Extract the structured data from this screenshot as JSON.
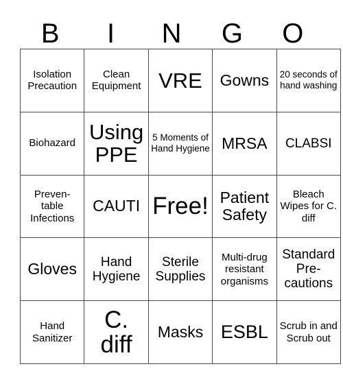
{
  "card": {
    "header_letters": [
      "B",
      "I",
      "N",
      "G",
      "O"
    ],
    "rows": [
      [
        {
          "text": "Isolation Precaution",
          "size": "fs-sm"
        },
        {
          "text": "Clean Equipment",
          "size": "fs-sm"
        },
        {
          "text": "VRE",
          "size": "fs-xxl"
        },
        {
          "text": "Gowns",
          "size": "fs-lg"
        },
        {
          "text": "20 seconds of hand washing",
          "size": "fs-xs"
        }
      ],
      [
        {
          "text": "Biohazard",
          "size": "fs-sm"
        },
        {
          "text": "Using PPE",
          "size": "fs-xxl"
        },
        {
          "text": "5 Moments of Hand Hygiene",
          "size": "fs-xs"
        },
        {
          "text": "MRSA",
          "size": "fs-lg"
        },
        {
          "text": "CLABSI",
          "size": "fs-md"
        }
      ],
      [
        {
          "text": "Preven- table Infections",
          "size": "fs-sm"
        },
        {
          "text": "CAUTI",
          "size": "fs-lg"
        },
        {
          "text": "Free!",
          "size": "fs-huge"
        },
        {
          "text": "Patient Safety",
          "size": "fs-lg"
        },
        {
          "text": "Bleach Wipes for C. diff",
          "size": "fs-sm"
        }
      ],
      [
        {
          "text": "Gloves",
          "size": "fs-lg"
        },
        {
          "text": "Hand Hygiene",
          "size": "fs-md"
        },
        {
          "text": "Sterile Supplies",
          "size": "fs-md"
        },
        {
          "text": "Multi-drug resistant organisms",
          "size": "fs-sm"
        },
        {
          "text": "Standard Pre- cautions",
          "size": "fs-md"
        }
      ],
      [
        {
          "text": "Hand Sanitizer",
          "size": "fs-sm"
        },
        {
          "text": "C. diff",
          "size": "fs-huge"
        },
        {
          "text": "Masks",
          "size": "fs-lg"
        },
        {
          "text": "ESBL",
          "size": "fs-xl"
        },
        {
          "text": "Scrub in and Scrub out",
          "size": "fs-sm"
        }
      ]
    ],
    "free_space": {
      "row": 2,
      "col": 2,
      "label": "Free!"
    },
    "colors": {
      "background": "#ffffff",
      "text": "#000000",
      "grid_line": "#4a4a4a"
    }
  }
}
